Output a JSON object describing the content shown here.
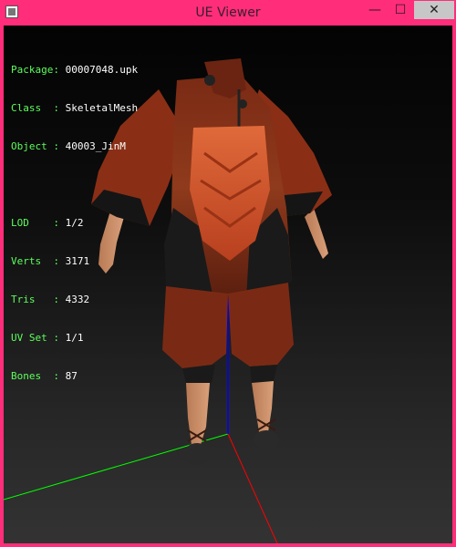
{
  "window": {
    "title": "UE Viewer",
    "buttons": {
      "minimize": "—",
      "maximize": "☐",
      "close": "✕"
    }
  },
  "info": [
    {
      "key": "Package:",
      "value": "00007048.upk"
    },
    {
      "key": "Class  :",
      "value": "SkeletalMesh"
    },
    {
      "key": "Object :",
      "value": "40003_JinM"
    }
  ],
  "stats": [
    {
      "key": "LOD    :",
      "value": "1/2"
    },
    {
      "key": "Verts  :",
      "value": "3171"
    },
    {
      "key": "Tris   :",
      "value": "4332"
    },
    {
      "key": "UV Set :",
      "value": "1/1"
    },
    {
      "key": "Bones  :",
      "value": "87"
    }
  ],
  "colors": {
    "frame": "#ff2d7a",
    "label": "#5cff5c",
    "axis_x": "#ff0000",
    "axis_y": "#00ff00",
    "axis_z": "#0000ff"
  }
}
